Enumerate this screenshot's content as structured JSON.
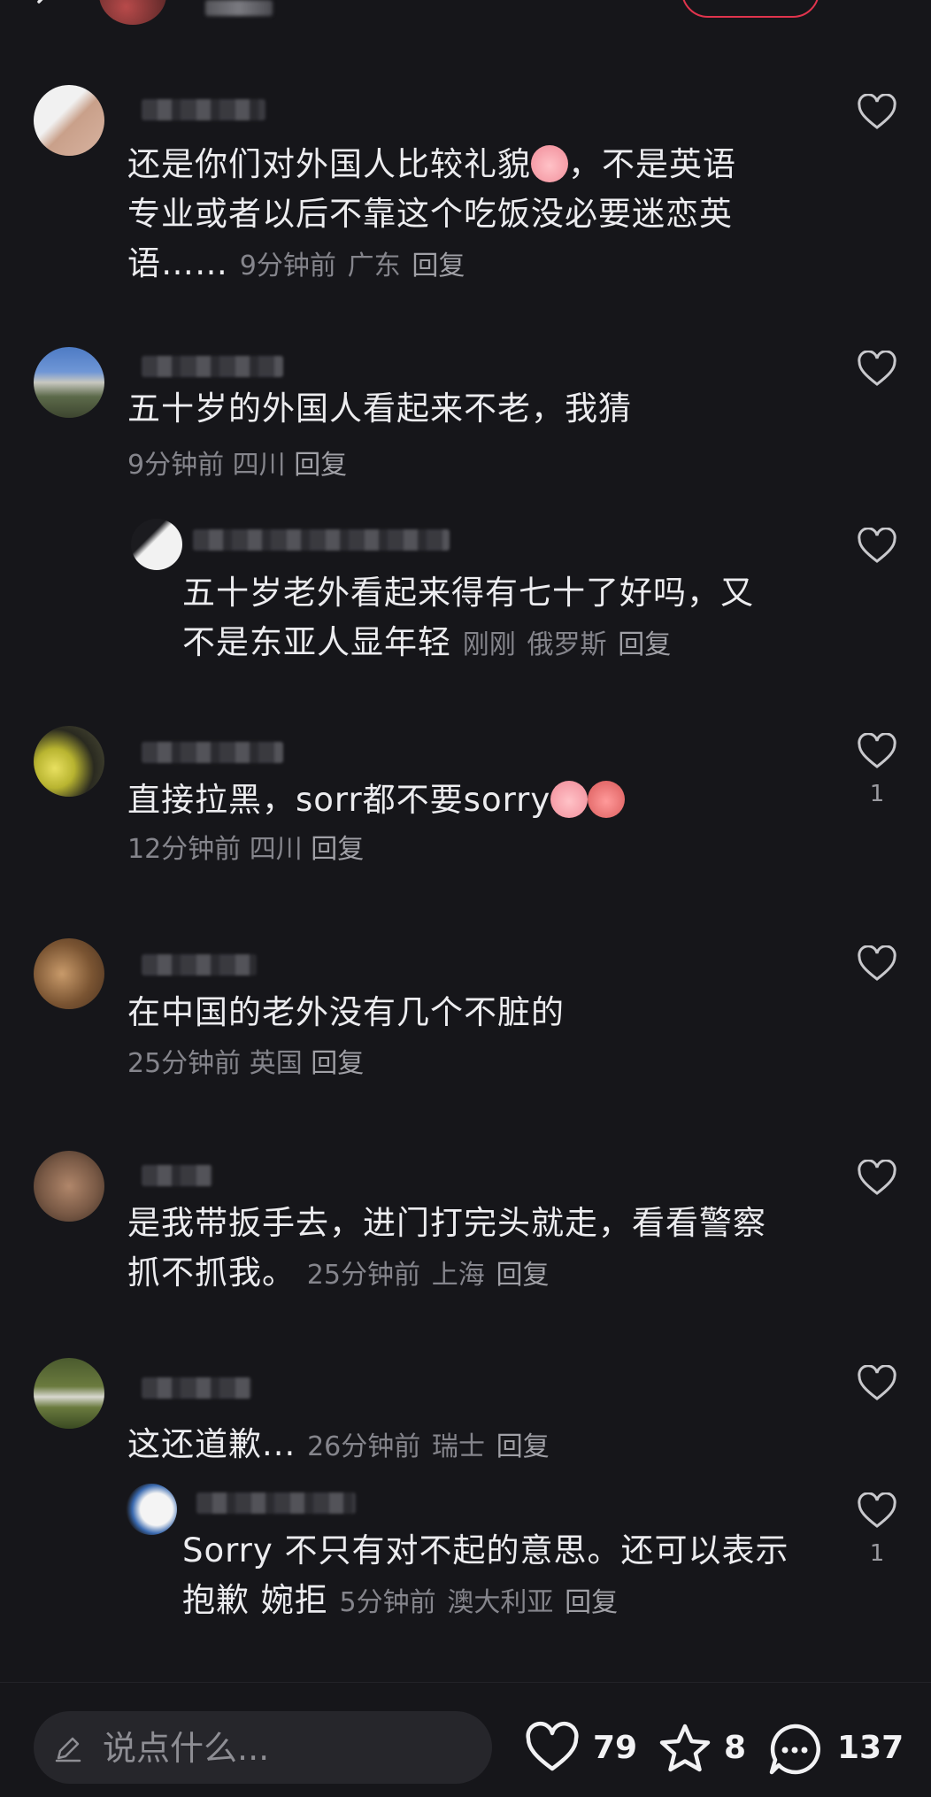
{
  "comments": [
    {
      "text_line1": "还是你们对外国人比较礼貌",
      "text_after_emoji": "，不是英语",
      "text_line2": "专业或者以后不靠这个吃饭没必要迷恋英",
      "text_line3": "语……",
      "time": "9分钟前",
      "location": "广东",
      "reply": "回复",
      "likes": ""
    },
    {
      "text": "五十岁的外国人看起来不老，我猜",
      "time": "9分钟前",
      "location": "四川",
      "reply": "回复",
      "likes": ""
    },
    {
      "text_line1": "五十岁老外看起来得有七十了好吗，又",
      "text_line2": "不是东亚人显年轻",
      "time": "刚刚",
      "location": "俄罗斯",
      "reply": "回复",
      "likes": ""
    },
    {
      "text": "直接拉黑，sorr都不要sorry",
      "time": "12分钟前",
      "location": "四川",
      "reply": "回复",
      "likes": "1"
    },
    {
      "text": "在中国的老外没有几个不脏的",
      "time": "25分钟前",
      "location": "英国",
      "reply": "回复",
      "likes": ""
    },
    {
      "text_line1": "是我带扳手去，进门打完头就走，看看警察",
      "text_line2": "抓不抓我。",
      "time": "25分钟前",
      "location": "上海",
      "reply": "回复",
      "likes": ""
    },
    {
      "text": "这还道歉...",
      "time": "26分钟前",
      "location": "瑞士",
      "reply": "回复",
      "likes": ""
    },
    {
      "text_line1": "Sorry 不只有对不起的意思。还可以表示",
      "text_line2": "抱歉 婉拒",
      "time": "5分钟前",
      "location": "澳大利亚",
      "reply": "回复",
      "likes": "1"
    }
  ],
  "bottom": {
    "placeholder": "说点什么...",
    "likes": "79",
    "favorites": "8",
    "comments": "137"
  },
  "icons": [
    "back-icon",
    "share-icon",
    "heart-icon",
    "pencil-icon",
    "star-icon",
    "comment-bubble-icon"
  ],
  "colors": {
    "background": "#16161a",
    "text": "#ececef",
    "meta": "#85858c",
    "accent": "#e0344d"
  }
}
